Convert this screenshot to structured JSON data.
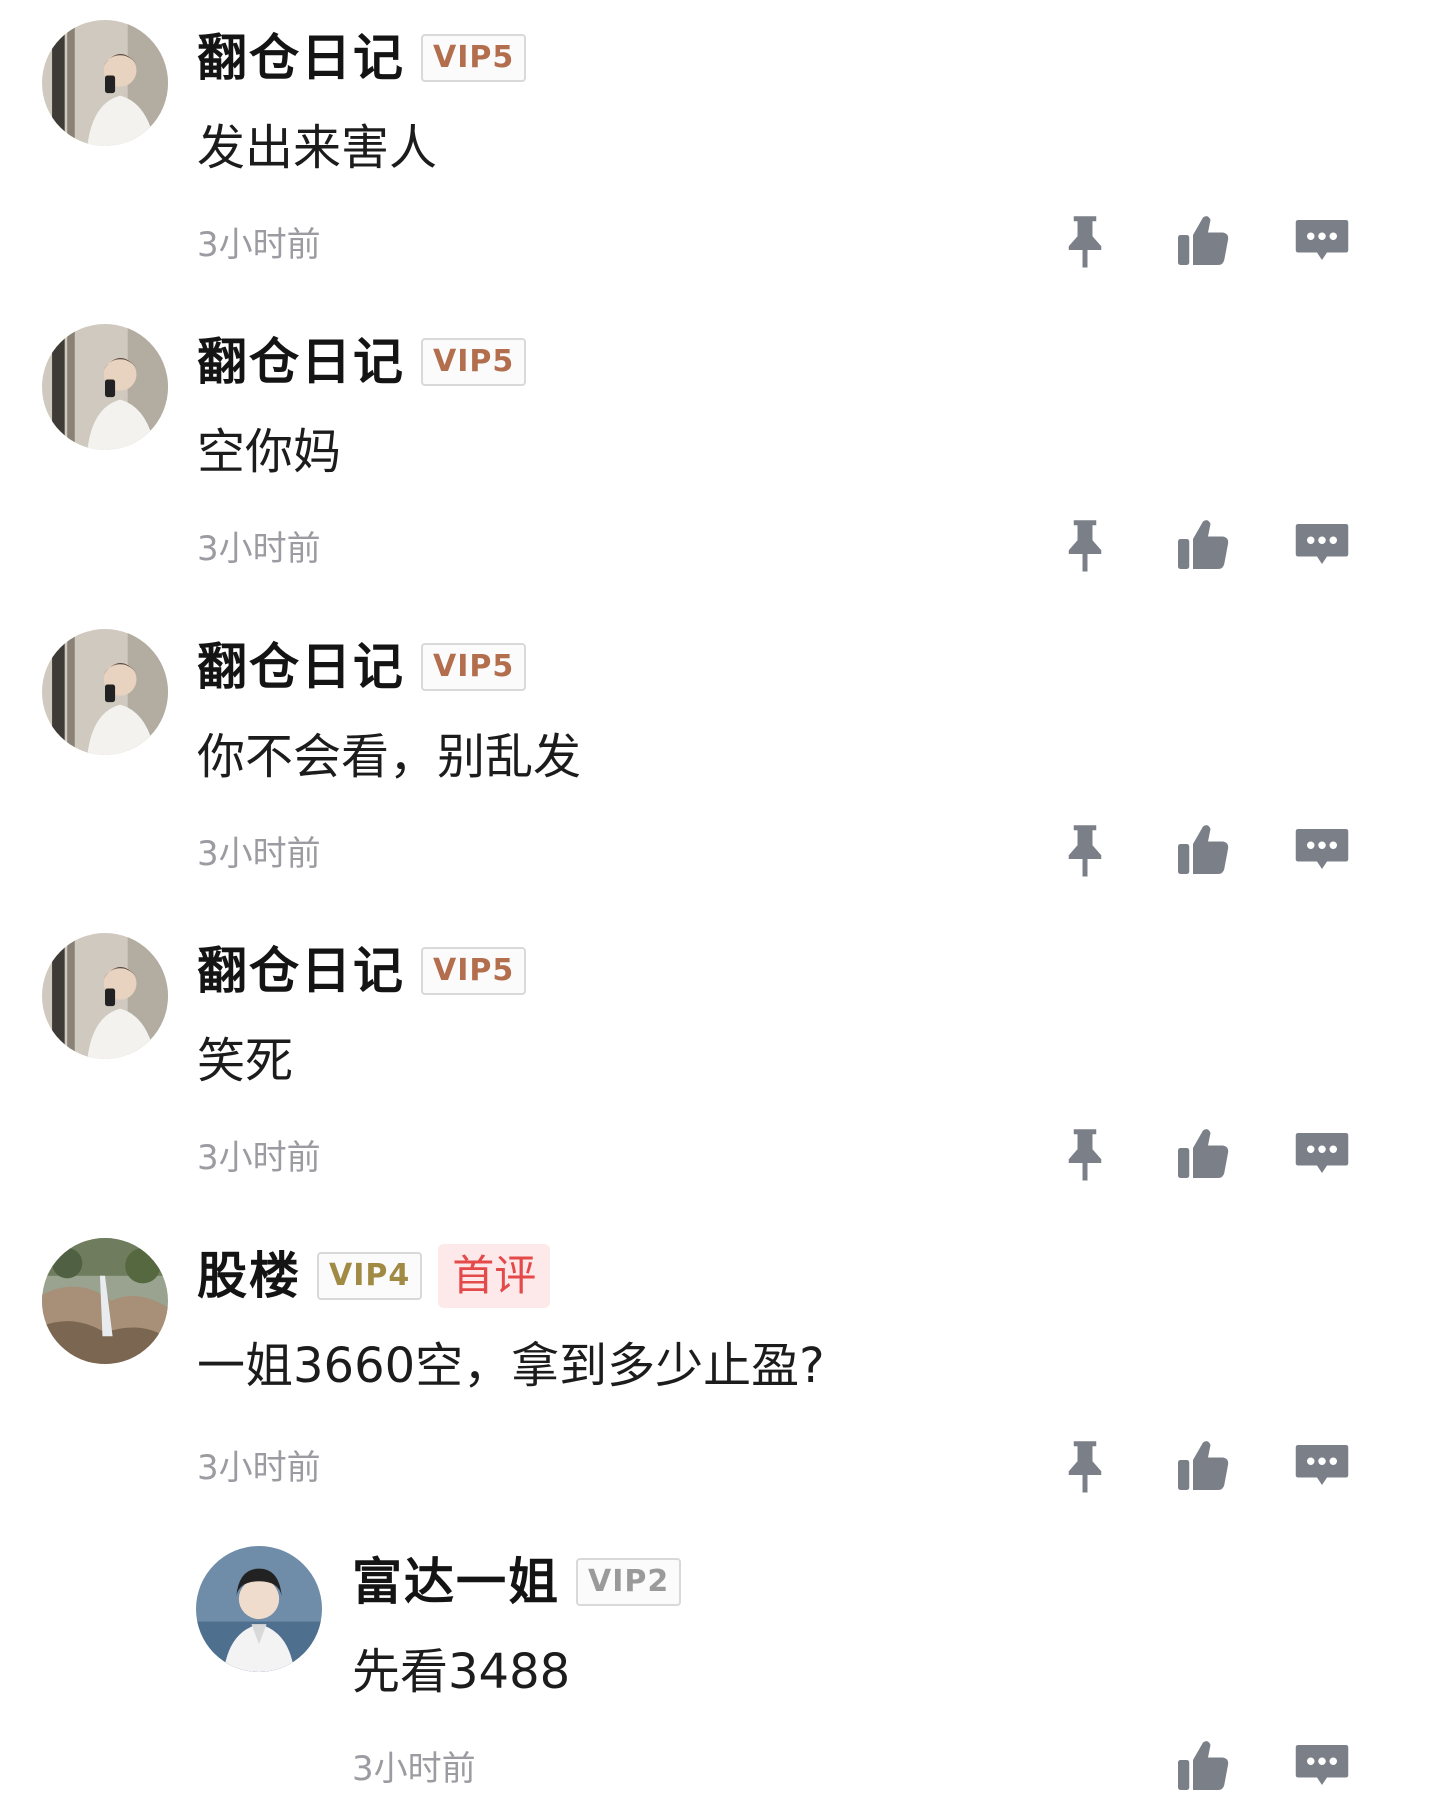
{
  "comments": [
    {
      "username": "翻仓日记",
      "vip": "VIP5",
      "text": "发出来害人",
      "time": "3小时前"
    },
    {
      "username": "翻仓日记",
      "vip": "VIP5",
      "text": "空你妈",
      "time": "3小时前"
    },
    {
      "username": "翻仓日记",
      "vip": "VIP5",
      "text": "你不会看，别乱发",
      "time": "3小时前"
    },
    {
      "username": "翻仓日记",
      "vip": "VIP5",
      "text": "笑死",
      "time": "3小时前"
    },
    {
      "username": "股楼",
      "vip": "VIP4",
      "badge": "首评",
      "text": "一姐3660空，拿到多少止盈?",
      "time": "3小时前"
    }
  ],
  "reply": {
    "username": "富达一姐",
    "vip": "VIP2",
    "text": "先看3488",
    "time": "3小时前"
  },
  "icons": {
    "pin": "pin-icon",
    "like": "thumbs-up-icon",
    "reply": "comment-icon"
  },
  "colors": {
    "icon": "#7b8088",
    "vip5": "#b26e4d",
    "vip4": "#a08a44",
    "vip2": "#9a9a9a",
    "first_badge_bg": "#fde9e9",
    "first_badge_text": "#e44a4a"
  }
}
